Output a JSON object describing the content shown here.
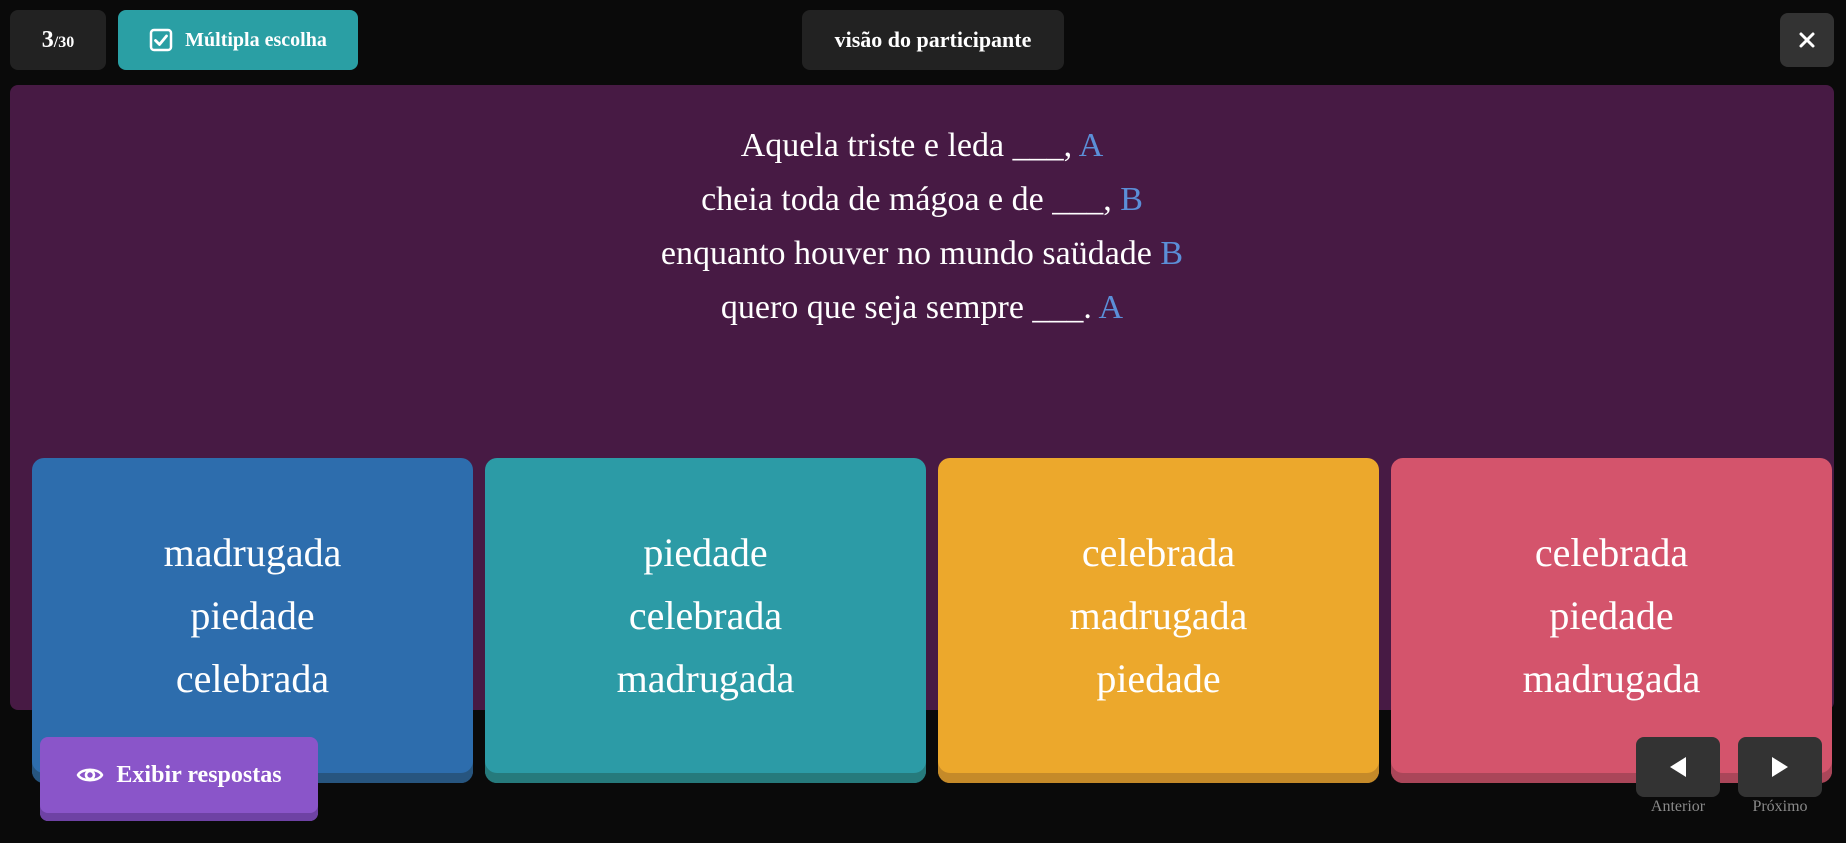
{
  "header": {
    "counter_current": "3",
    "counter_total": "/30",
    "question_type": "Múltipla escolha",
    "question_type_icon": "checkbox-checked-icon",
    "view_mode": "visão do participante",
    "close_icon": "close-icon"
  },
  "question": {
    "lines": [
      {
        "text": "Aquela triste e leda ___,",
        "rhyme": "A"
      },
      {
        "text": "cheia toda de mágoa e de ___,",
        "rhyme": "B"
      },
      {
        "text": "enquanto houver no mundo saüdade",
        "rhyme": "B"
      },
      {
        "text": "quero que seja sempre ___.",
        "rhyme": "A"
      }
    ]
  },
  "answers": [
    {
      "color": "#2d6dad",
      "words": [
        "madrugada",
        "piedade",
        "celebrada"
      ]
    },
    {
      "color": "#2c9ba6",
      "words": [
        "piedade",
        "celebrada",
        "madrugada"
      ]
    },
    {
      "color": "#eca82c",
      "words": [
        "celebrada",
        "madrugada",
        "piedade"
      ]
    },
    {
      "color": "#d4546c",
      "words": [
        "celebrada",
        "piedade",
        "madrugada"
      ]
    }
  ],
  "footer": {
    "show_answers_label": "Exibir respostas",
    "show_answers_icon": "eye-icon",
    "prev_label": "Anterior",
    "next_label": "Próximo"
  },
  "colors": {
    "background": "#0a0a0a",
    "panel": "#471a44",
    "accent_teal": "#2a9fa4",
    "accent_purple": "#8a55c9",
    "rhyme_blue": "#5b8fd8"
  }
}
